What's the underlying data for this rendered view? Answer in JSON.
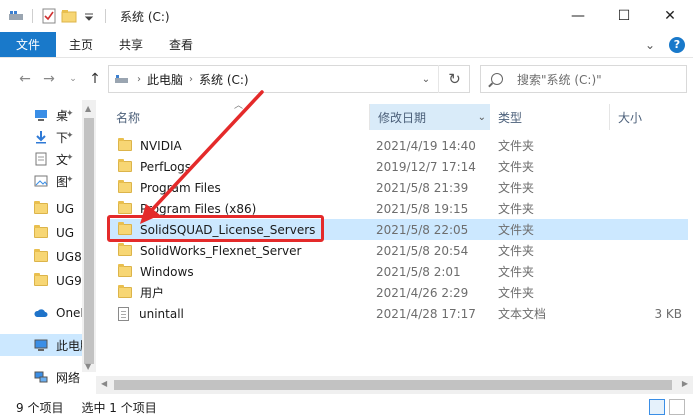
{
  "window": {
    "title": "系统 (C:)",
    "controls": [
      "—",
      "☐",
      "✕"
    ]
  },
  "ribbon": {
    "tabs": [
      "文件",
      "主页",
      "共享",
      "查看"
    ],
    "right_icons": [
      "chevron-down-icon",
      "help-icon"
    ],
    "help_label": "?"
  },
  "address": {
    "crumbs": [
      "此电脑",
      "系统 (C:)"
    ],
    "search_placeholder": "搜索\"系统 (C:)\""
  },
  "nav_pane": {
    "items": [
      {
        "label": "桌",
        "icon": "desktop-icon"
      },
      {
        "label": "下",
        "icon": "download-icon"
      },
      {
        "label": "文",
        "icon": "document-icon"
      },
      {
        "label": "图",
        "icon": "picture-icon"
      },
      {
        "label": "UG",
        "icon": "folder-icon"
      },
      {
        "label": "UG",
        "icon": "folder-icon"
      },
      {
        "label": "UG8",
        "icon": "folder-icon"
      },
      {
        "label": "UG9",
        "icon": "folder-icon"
      },
      {
        "label": "OneD",
        "icon": "cloud-icon"
      },
      {
        "label": "此电脑",
        "icon": "computer-icon"
      },
      {
        "label": "网络",
        "icon": "network-icon"
      }
    ]
  },
  "columns": {
    "name": "名称",
    "date": "修改日期",
    "type": "类型",
    "size": "大小"
  },
  "files": [
    {
      "name": "NVIDIA",
      "date": "2021/4/19 14:40",
      "type": "文件夹",
      "size": "",
      "kind": "folder"
    },
    {
      "name": "PerfLogs",
      "date": "2019/12/7 17:14",
      "type": "文件夹",
      "size": "",
      "kind": "folder"
    },
    {
      "name": "Program Files",
      "date": "2021/5/8 21:39",
      "type": "文件夹",
      "size": "",
      "kind": "folder"
    },
    {
      "name": "Program Files (x86)",
      "date": "2021/5/8 19:15",
      "type": "文件夹",
      "size": "",
      "kind": "folder"
    },
    {
      "name": "SolidSQUAD_License_Servers",
      "date": "2021/5/8 22:05",
      "type": "文件夹",
      "size": "",
      "kind": "folder",
      "selected": true
    },
    {
      "name": "SolidWorks_Flexnet_Server",
      "date": "2021/5/8 20:54",
      "type": "文件夹",
      "size": "",
      "kind": "folder"
    },
    {
      "name": "Windows",
      "date": "2021/5/8 2:01",
      "type": "文件夹",
      "size": "",
      "kind": "folder"
    },
    {
      "name": "用户",
      "date": "2021/4/26 2:29",
      "type": "文件夹",
      "size": "",
      "kind": "folder"
    },
    {
      "name": "unintall",
      "date": "2021/4/28 17:17",
      "type": "文本文档",
      "size": "3 KB",
      "kind": "text"
    }
  ],
  "status": {
    "count": "9 个项目",
    "selected": "选中 1 个项目"
  },
  "colors": {
    "accent": "#1979ca",
    "selection": "#cce8ff",
    "annotation": "#e42a2a"
  }
}
